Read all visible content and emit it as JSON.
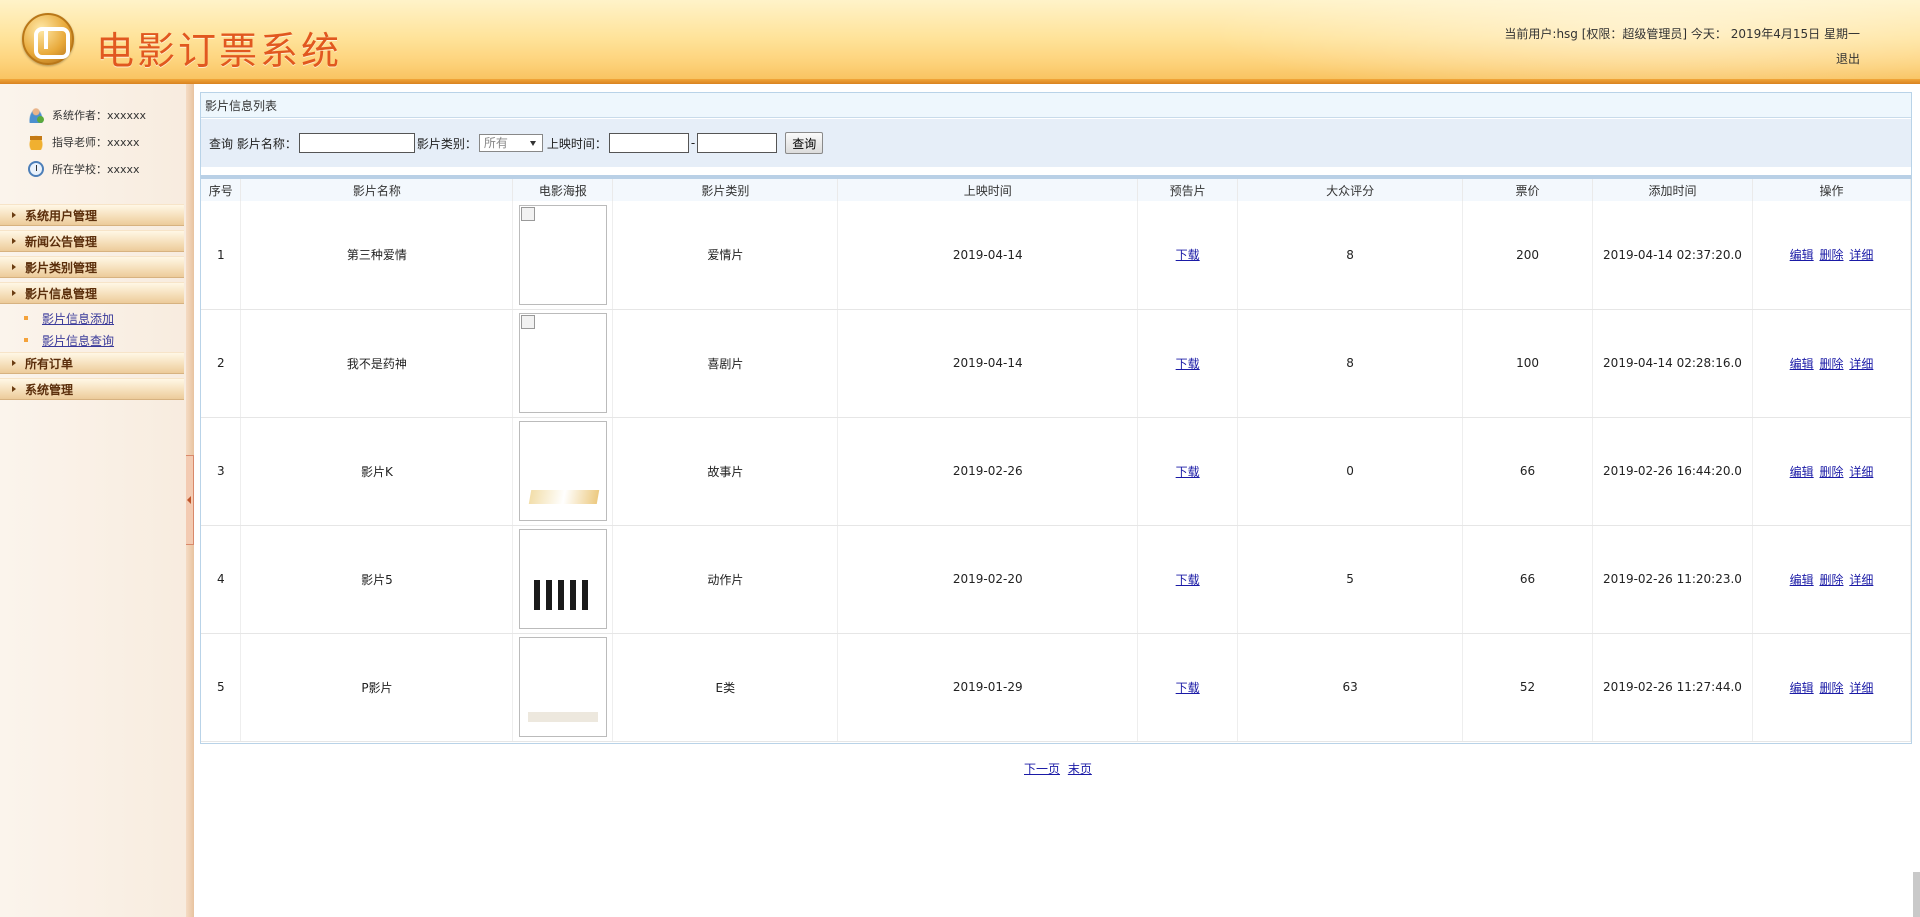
{
  "header": {
    "app_title": "电影订票系统",
    "user_info": "当前用户:hsg [权限：超级管理员] 今天： 2019年4月15日 星期一",
    "logout": "退出"
  },
  "sidebar": {
    "info": [
      {
        "label": "系统作者：xxxxxx",
        "icon": "person-icon"
      },
      {
        "label": "指导老师：xxxxx",
        "icon": "teacher-icon"
      },
      {
        "label": "所在学校：xxxxx",
        "icon": "school-icon"
      }
    ],
    "menus": [
      {
        "label": "系统用户管理"
      },
      {
        "label": "新闻公告管理"
      },
      {
        "label": "影片类别管理"
      },
      {
        "label": "影片信息管理"
      },
      {
        "label": "所有订单"
      },
      {
        "label": "系统管理"
      }
    ],
    "submenu": [
      {
        "label": "影片信息添加"
      },
      {
        "label": "影片信息查询"
      }
    ]
  },
  "panel": {
    "title": "影片信息列表"
  },
  "search": {
    "prefix": "查询 影片名称：",
    "category_label": "影片类别：",
    "category_value": "所有",
    "date_label": "上映时间：",
    "date_sep": "-",
    "name_value": "",
    "date_from_value": "",
    "date_to_value": "",
    "button": "查询"
  },
  "table": {
    "columns": [
      "序号",
      "影片名称",
      "电影海报",
      "影片类别",
      "上映时间",
      "预告片",
      "大众评分",
      "票价",
      "添加时间",
      "操作"
    ],
    "rows": [
      {
        "no": "1",
        "name": "第三种爱情",
        "poster": "broken-image",
        "category": "爱情片",
        "release": "2019-04-14",
        "trailer": "下载",
        "rating": "8",
        "price": "200",
        "added": "2019-04-14 02:37:20.0"
      },
      {
        "no": "2",
        "name": "我不是药神",
        "poster": "broken-image",
        "category": "喜剧片",
        "release": "2019-04-14",
        "trailer": "下载",
        "rating": "8",
        "price": "100",
        "added": "2019-04-14 02:28:16.0"
      },
      {
        "no": "3",
        "name": "影片K",
        "poster": "war-poster",
        "category": "故事片",
        "release": "2019-02-26",
        "trailer": "下载",
        "rating": "0",
        "price": "66",
        "added": "2019-02-26 16:44:20.0"
      },
      {
        "no": "4",
        "name": "影片5",
        "poster": "street-poster",
        "category": "动作片",
        "release": "2019-02-20",
        "trailer": "下载",
        "rating": "5",
        "price": "66",
        "added": "2019-02-26 11:20:23.0"
      },
      {
        "no": "5",
        "name": "P影片",
        "poster": "period-poster",
        "category": "E类",
        "release": "2019-01-29",
        "trailer": "下载",
        "rating": "63",
        "price": "52",
        "added": "2019-02-26 11:27:44.0"
      }
    ],
    "actions": {
      "edit": "编辑",
      "delete": "删除",
      "detail": "详细"
    }
  },
  "pager": {
    "next": "下一页",
    "last": "末页"
  },
  "colors": {
    "title_orange": "#e1581f",
    "link_blue": "#1a1aa6",
    "menu_text": "#5b2e0b"
  }
}
